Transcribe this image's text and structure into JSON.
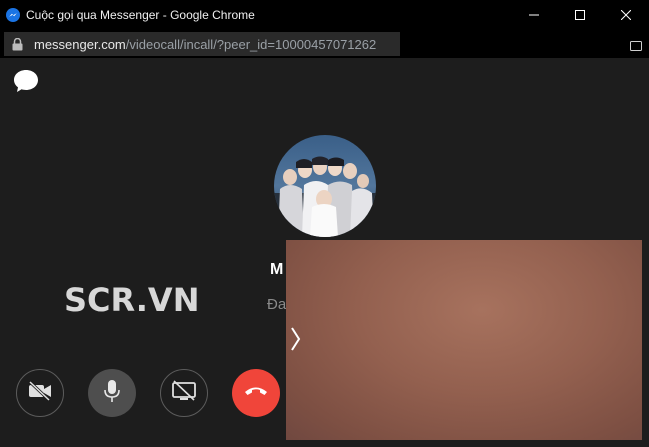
{
  "window": {
    "title": "Cuộc gọi qua Messenger - Google Chrome",
    "url_host": "messenger.com",
    "url_path": "/videocall/incall/?peer_id=10000457071262"
  },
  "call": {
    "caller_name": "M",
    "status_text": "Đa"
  },
  "watermark": "SCR.VN",
  "icons": {
    "messenger": "messenger-icon",
    "chat": "chat-bubble-icon",
    "camera_off": "camera-off-icon",
    "mic": "microphone-icon",
    "screen_share_off": "screen-share-off-icon",
    "end_call": "phone-hangup-icon",
    "expand": "chevron-right-icon"
  },
  "colors": {
    "end_call": "#f0453a",
    "messenger_blue": "#1b74e4",
    "background": "#1d1d1d"
  }
}
